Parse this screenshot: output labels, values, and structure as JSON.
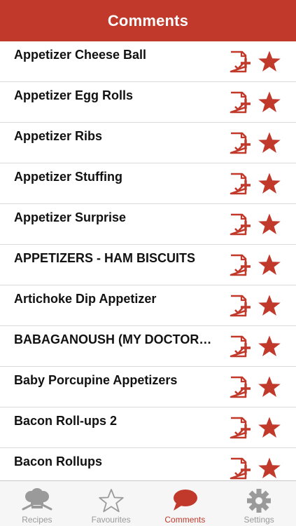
{
  "nav": {
    "title": "Comments"
  },
  "colors": {
    "accent": "#c0392b",
    "tab_inactive": "#9a9a9a"
  },
  "rows": [
    {
      "title": "Appetizer Cheese Ball"
    },
    {
      "title": "Appetizer Egg Rolls"
    },
    {
      "title": "Appetizer Ribs"
    },
    {
      "title": "Appetizer Stuffing"
    },
    {
      "title": "Appetizer Surprise"
    },
    {
      "title": "APPETIZERS - HAM BISCUITS"
    },
    {
      "title": "Artichoke Dip Appetizer"
    },
    {
      "title": "BABAGANOUSH (MY DOCTOR…"
    },
    {
      "title": "Baby Porcupine Appetizers"
    },
    {
      "title": "Bacon Roll-ups 2"
    },
    {
      "title": "Bacon Rollups"
    }
  ],
  "row_icons": {
    "comment": "add-note-icon",
    "favourite": "star-icon"
  },
  "tabs": [
    {
      "label": "Recipes",
      "icon": "chef-hat-icon",
      "active": false
    },
    {
      "label": "Favourites",
      "icon": "star-outline-icon",
      "active": false
    },
    {
      "label": "Comments",
      "icon": "speech-bubble-icon",
      "active": true
    },
    {
      "label": "Settings",
      "icon": "gear-icon",
      "active": false
    }
  ]
}
